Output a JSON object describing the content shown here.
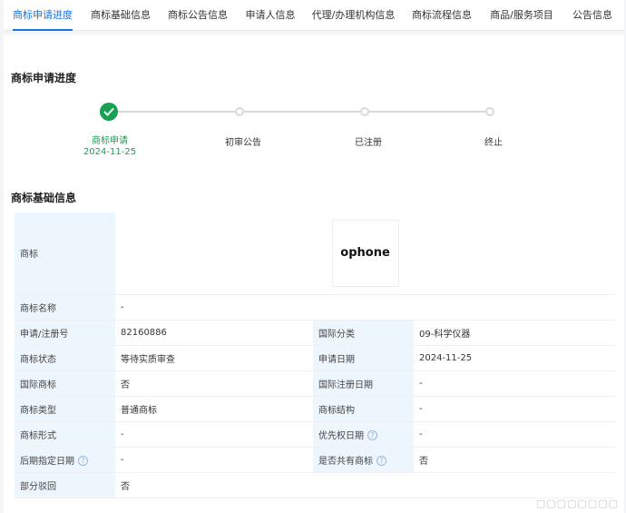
{
  "tabs": [
    {
      "label": "商标申请进度",
      "active": true
    },
    {
      "label": "商标基础信息"
    },
    {
      "label": "商标公告信息"
    },
    {
      "label": "申请人信息"
    },
    {
      "label": "代理/办理机构信息"
    },
    {
      "label": "商标流程信息"
    },
    {
      "label": "商品/服务项目"
    },
    {
      "label": "公告信息"
    }
  ],
  "progress": {
    "title": "商标申请进度",
    "steps": [
      {
        "label": "商标申请",
        "date": "2024-11-25",
        "status": "done"
      },
      {
        "label": "初审公告",
        "status": "pending"
      },
      {
        "label": "已注册",
        "status": "pending"
      },
      {
        "label": "终止",
        "status": "pending"
      }
    ]
  },
  "basic": {
    "title": "商标基础信息",
    "trademark_label": "商标",
    "trademark_text": "ophone",
    "rows": {
      "name_label": "商标名称",
      "name_value": "-",
      "reg_no_label": "申请/注册号",
      "reg_no_value": "82160886",
      "intl_class_label": "国际分类",
      "intl_class_value": "09-科学仪器",
      "status_label": "商标状态",
      "status_value": "等待实质审查",
      "apply_date_label": "申请日期",
      "apply_date_value": "2024-11-25",
      "intl_mark_label": "国际商标",
      "intl_mark_value": "否",
      "intl_reg_date_label": "国际注册日期",
      "intl_reg_date_value": "-",
      "type_label": "商标类型",
      "type_value": "普通商标",
      "structure_label": "商标结构",
      "structure_value": "-",
      "form_label": "商标形式",
      "form_value": "-",
      "priority_label": "优先权日期",
      "priority_value": "-",
      "later_date_label": "后期指定日期",
      "later_date_value": "-",
      "shared_label": "是否共有商标",
      "shared_value": "否",
      "partial_label": "部分驳回",
      "partial_value": "否"
    }
  },
  "colors": {
    "accent": "#1a73e8",
    "success": "#19a054",
    "label_bg": "#edf5fd"
  },
  "watermark": "▢▢▢▢▢▢▢▢"
}
